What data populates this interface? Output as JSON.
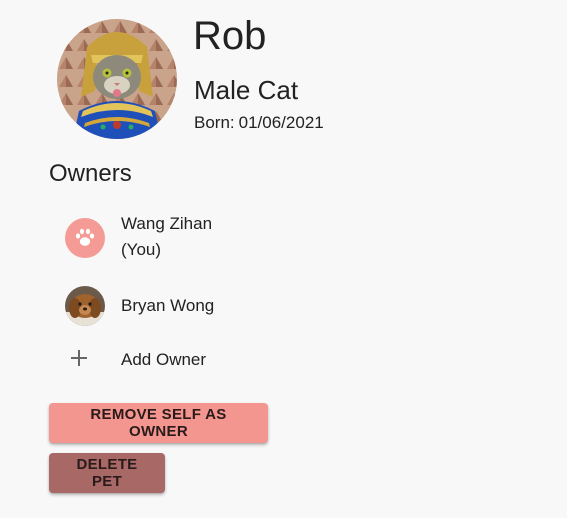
{
  "pet": {
    "name": "Rob",
    "type": "Male Cat",
    "born_label": "Born:",
    "born_date": "01/06/2021",
    "photo_icon": "cat-pharaoh-photo"
  },
  "owners": {
    "heading": "Owners",
    "items": [
      {
        "name": "Wang Zihan",
        "note": "(You)",
        "avatar_icon": "paw-icon",
        "avatar_color": "#f39b94"
      },
      {
        "name": "Bryan Wong",
        "avatar_icon": "dog-photo"
      }
    ],
    "add_label": "Add Owner",
    "add_icon": "plus-icon"
  },
  "actions": {
    "remove_label": "Remove self as owner",
    "delete_label": "Delete pet",
    "remove_color": "#f3968f",
    "delete_color": "#a86865"
  }
}
